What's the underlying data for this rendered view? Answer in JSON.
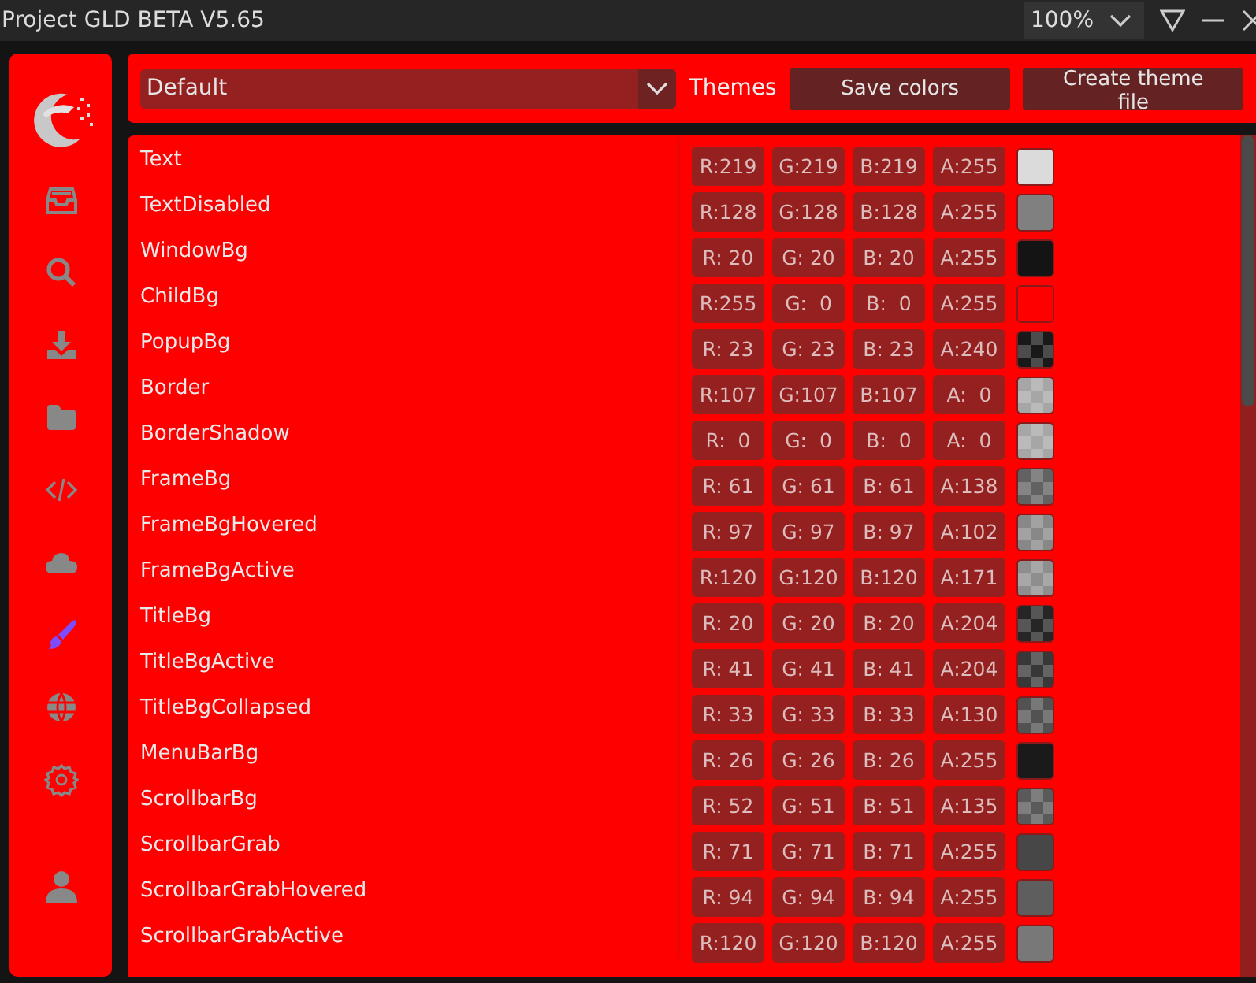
{
  "window": {
    "title": "Project GLD BETA V5.65",
    "zoom": "100%"
  },
  "sidebar": {
    "items": [
      {
        "selected": false
      },
      {
        "selected": false
      },
      {
        "selected": false
      },
      {
        "selected": false
      },
      {
        "selected": false
      },
      {
        "selected": false
      },
      {
        "selected": true
      },
      {
        "selected": false
      },
      {
        "selected": false
      },
      {
        "selected": false
      }
    ]
  },
  "toolbar": {
    "theme_select": "Default",
    "themes_label": "Themes",
    "buttons": [
      "Save colors",
      "Create theme file"
    ]
  },
  "colors": [
    {
      "name": "Text",
      "r": "R:219",
      "g": "G:219",
      "b": "B:219",
      "a": "A:255",
      "color": "#dbdbdb",
      "kind": "opaque"
    },
    {
      "name": "TextDisabled",
      "r": "R:128",
      "g": "G:128",
      "b": "B:128",
      "a": "A:255",
      "color": "#808080",
      "kind": "opaque"
    },
    {
      "name": "WindowBg",
      "r": "R: 20",
      "g": "G: 20",
      "b": "B: 20",
      "a": "A:255",
      "color": "#141414",
      "kind": "opaque"
    },
    {
      "name": "ChildBg",
      "r": "R:255",
      "g": "G:  0",
      "b": "B:  0",
      "a": "A:255",
      "color": "#ff0000",
      "kind": "opaque"
    },
    {
      "name": "PopupBg",
      "r": "R: 23",
      "g": "G: 23",
      "b": "B: 23",
      "a": "A:240",
      "color": "#191919",
      "kind": "translucent"
    },
    {
      "name": "Border",
      "r": "R:107",
      "g": "G:107",
      "b": "B:107",
      "a": "A:  0",
      "color": "#a6a6a6",
      "kind": "translucent"
    },
    {
      "name": "BorderShadow",
      "r": "R:  0",
      "g": "G:  0",
      "b": "B:  0",
      "a": "A:  0",
      "color": "#a6a6a6",
      "kind": "translucent"
    },
    {
      "name": "FrameBg",
      "r": "R: 61",
      "g": "G: 61",
      "b": "B: 61",
      "a": "A:138",
      "color": "#626262",
      "kind": "translucent"
    },
    {
      "name": "FrameBgHovered",
      "r": "R: 97",
      "g": "G: 97",
      "b": "B: 97",
      "a": "A:102",
      "color": "#888888",
      "kind": "translucent"
    },
    {
      "name": "FrameBgActive",
      "r": "R:120",
      "g": "G:120",
      "b": "B:120",
      "a": "A:171",
      "color": "#8e8e8e",
      "kind": "translucent"
    },
    {
      "name": "TitleBg",
      "r": "R: 20",
      "g": "G: 20",
      "b": "B: 20",
      "a": "A:204",
      "color": "#262626",
      "kind": "translucent"
    },
    {
      "name": "TitleBgActive",
      "r": "R: 41",
      "g": "G: 41",
      "b": "B: 41",
      "a": "A:204",
      "color": "#383838",
      "kind": "translucent"
    },
    {
      "name": "TitleBgCollapsed",
      "r": "R: 33",
      "g": "G: 33",
      "b": "B: 33",
      "a": "A:130",
      "color": "#525252",
      "kind": "translucent"
    },
    {
      "name": "MenuBarBg",
      "r": "R: 26",
      "g": "G: 26",
      "b": "B: 26",
      "a": "A:255",
      "color": "#1a1a1a",
      "kind": "opaque"
    },
    {
      "name": "ScrollbarBg",
      "r": "R: 52",
      "g": "G: 51",
      "b": "B: 51",
      "a": "A:135",
      "color": "#5a5a5a",
      "kind": "translucent"
    },
    {
      "name": "ScrollbarGrab",
      "r": "R: 71",
      "g": "G: 71",
      "b": "B: 71",
      "a": "A:255",
      "color": "#474747",
      "kind": "opaque"
    },
    {
      "name": "ScrollbarGrabHovered",
      "r": "R: 94",
      "g": "G: 94",
      "b": "B: 94",
      "a": "A:255",
      "color": "#5e5e5e",
      "kind": "opaque"
    },
    {
      "name": "ScrollbarGrabActive",
      "r": "R:120",
      "g": "G:120",
      "b": "B:120",
      "a": "A:255",
      "color": "#787878",
      "kind": "opaque"
    }
  ]
}
